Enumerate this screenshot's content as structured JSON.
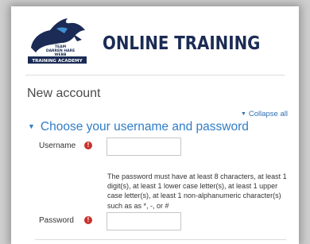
{
  "header": {
    "logo_text": [
      "TEAM",
      "DARREN HARE",
      "WEBB"
    ],
    "logo_banner": "TRAINING ACADEMY",
    "title": "ONLINE TRAINING"
  },
  "page": {
    "heading": "New account",
    "collapse_all": "Collapse all"
  },
  "section": {
    "title": "Choose your username and password"
  },
  "form": {
    "username_label": "Username",
    "username_value": "",
    "password_policy": "The password must have at least 8 characters, at least 1 digit(s), at least 1 lower case letter(s), at least 1 upper case letter(s), at least 1 non-alphanumeric character(s) such as as *, -, or #",
    "password_label": "Password",
    "password_value": ""
  },
  "colors": {
    "brand_navy": "#1b2b55",
    "link_blue": "#2f7dc7",
    "required_red": "#c9302c"
  },
  "icons": {
    "required": "exclamation-circle-icon",
    "section_toggle": "chevron-down-icon",
    "collapse": "triangle-down-icon"
  }
}
